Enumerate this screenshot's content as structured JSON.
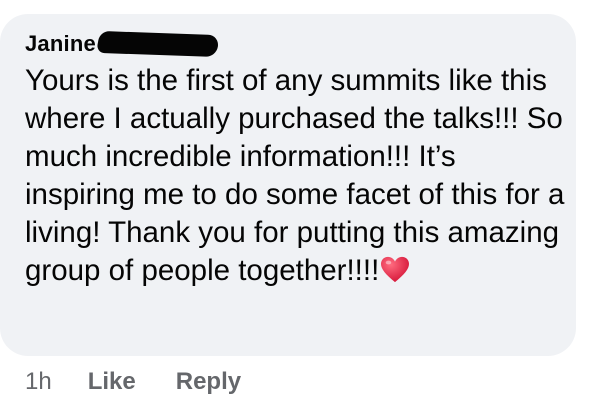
{
  "comment": {
    "author_name": "Janine",
    "text": "Yours is the first of any summits like this where I actually purchased the talks!!! So much incredible information!!! It’s inspiring me to do some facet of this for a living! Thank you for putting this amazing group of people together!!!!",
    "emoji": "heart-icon",
    "heart_color": "#e0245e",
    "bubble_color": "#f0f2f5"
  },
  "actions": {
    "timestamp": "1h",
    "like_label": "Like",
    "reply_label": "Reply"
  }
}
